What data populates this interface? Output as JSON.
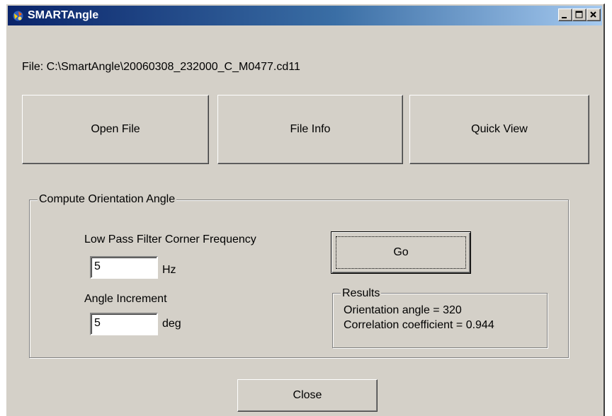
{
  "window": {
    "title": "SMARTAngle",
    "icon": "smartangle-app-icon",
    "controls": [
      "minimize-icon",
      "maximize-icon",
      "close-icon"
    ]
  },
  "file_label": "File: C:\\SmartAngle\\20060308_232000_C_M0477.cd11",
  "buttons": {
    "open_file": "Open File",
    "file_info": "File Info",
    "quick_view": "Quick View",
    "go": "Go",
    "close": "Close"
  },
  "compute_group": {
    "title": "Compute Orientation Angle",
    "lowpass_label": "Low Pass Filter Corner Frequency",
    "lowpass_value": "5",
    "lowpass_unit": "Hz",
    "angle_label": "Angle Increment",
    "angle_value": "5",
    "angle_unit": "deg"
  },
  "results": {
    "title": "Results",
    "orientation": "Orientation angle = 320",
    "correlation": "Correlation coefficient = 0.944"
  },
  "colors": {
    "dialog_face": "#d4d0c8",
    "title_gradient_start": "#0a246a",
    "title_gradient_end": "#a6caf0"
  }
}
